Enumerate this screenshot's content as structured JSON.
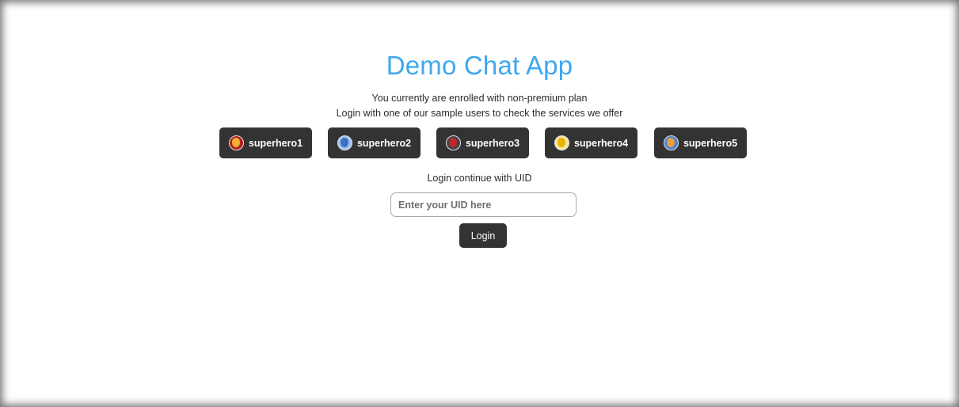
{
  "app": {
    "title": "Demo Chat App",
    "plan_notice": "You currently are enrolled with non-premium plan",
    "sample_users_hint": "Login with one of our sample users to check the services we offer"
  },
  "sample_users": [
    {
      "label": "superhero1",
      "icon": "iron-man-avatar-icon",
      "color": "#d9541e"
    },
    {
      "label": "superhero2",
      "icon": "captain-america-avatar-icon",
      "color": "#4a7fd6"
    },
    {
      "label": "superhero3",
      "icon": "spider-man-avatar-icon",
      "color": "#c1272d"
    },
    {
      "label": "superhero4",
      "icon": "wolverine-avatar-icon",
      "color": "#f0c419"
    },
    {
      "label": "superhero5",
      "icon": "cyclops-avatar-icon",
      "color": "#e8a23a"
    }
  ],
  "uid_login": {
    "label": "Login continue with UID",
    "placeholder": "Enter your UID here",
    "value": "",
    "button_label": "Login"
  },
  "colors": {
    "title": "#3ea8ee",
    "button_bg": "#333333",
    "button_text": "#ffffff"
  }
}
